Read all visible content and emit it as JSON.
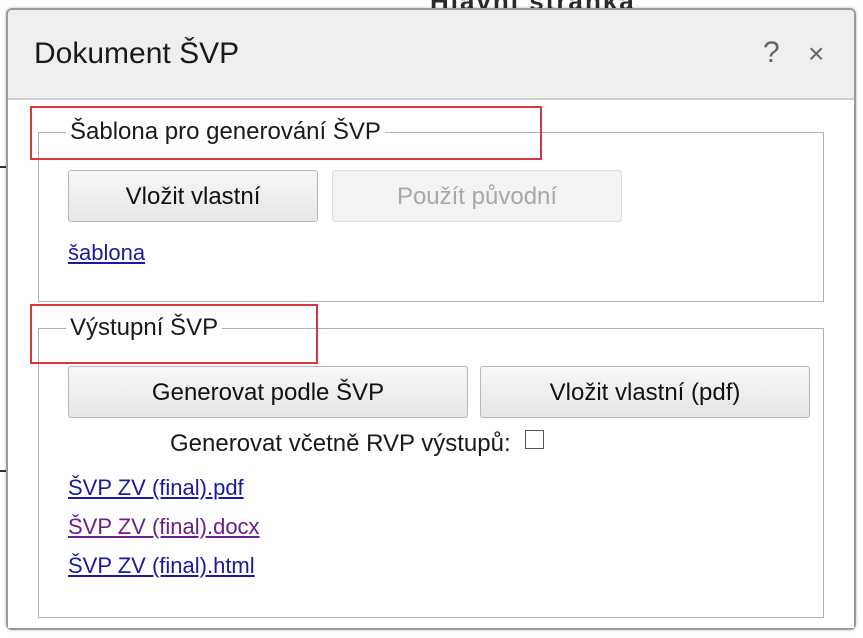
{
  "background": {
    "partial_text": "Hlavní  stránka"
  },
  "dialog": {
    "title": "Dokument ŠVP",
    "help_label": "?",
    "close_label": "×"
  },
  "template_section": {
    "legend": "Šablona pro generování ŠVP",
    "insert_button": "Vložit vlastní",
    "use_original_button": "Použít původní",
    "template_link": "šablona"
  },
  "output_section": {
    "legend": "Výstupní ŠVP",
    "generate_button": "Generovat podle ŠVP",
    "insert_pdf_button": "Vložit vlastní (pdf)",
    "include_rvp_label": "Generovat včetně RVP výstupů:",
    "include_rvp_checked": false,
    "files": [
      {
        "label": "ŠVP ZV (final).pdf",
        "visited": false
      },
      {
        "label": "ŠVP ZV (final).docx",
        "visited": true
      },
      {
        "label": "ŠVP ZV (final).html",
        "visited": false
      }
    ]
  },
  "colors": {
    "highlight": "#d9363e",
    "link": "#1a1a9c",
    "link_visited": "#6a1f8a",
    "disabled_text": "#a8a8a8"
  }
}
